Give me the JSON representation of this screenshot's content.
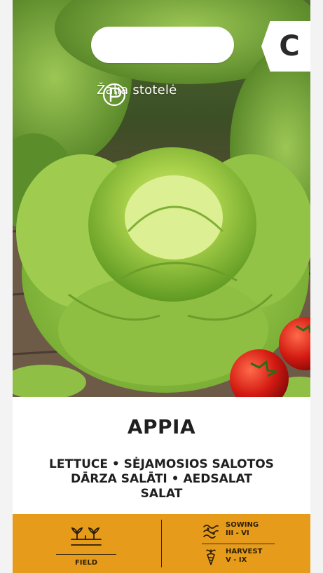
{
  "brand": {
    "name": "Žalia stotelė",
    "logo_icon": "zalia-stotele-logo"
  },
  "class_badge": "C",
  "variety": "APPIA",
  "names": [
    "LETTUCE • SĖJAMOSIOS SALOTOS",
    "DĀRZA SALĀTI • AEDSALAT",
    "SALAT"
  ],
  "info": {
    "field_label": "FIELD",
    "field_icon": "seedling-row-icon",
    "sowing_label": "SOWING",
    "sowing_months": "III - VI",
    "sowing_icon": "sowing-icon",
    "harvest_label": "HARVEST",
    "harvest_months": "V - IX",
    "harvest_icon": "harvest-icon"
  },
  "colors": {
    "accent_bar": "#e69b1b",
    "text_dark": "#1f1f1f"
  }
}
